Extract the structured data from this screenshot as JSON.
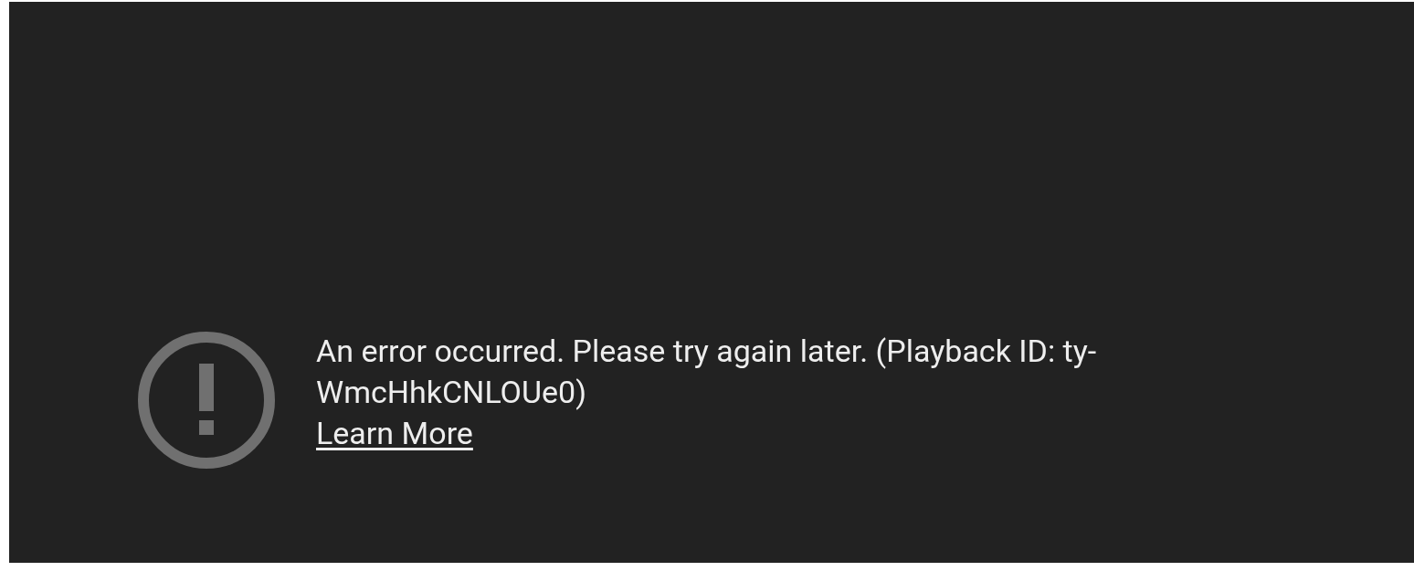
{
  "error": {
    "message": "An error occurred. Please try again later. (Playback ID: ty-WmcHhkCNLOUe0)",
    "link": "Learn More"
  }
}
